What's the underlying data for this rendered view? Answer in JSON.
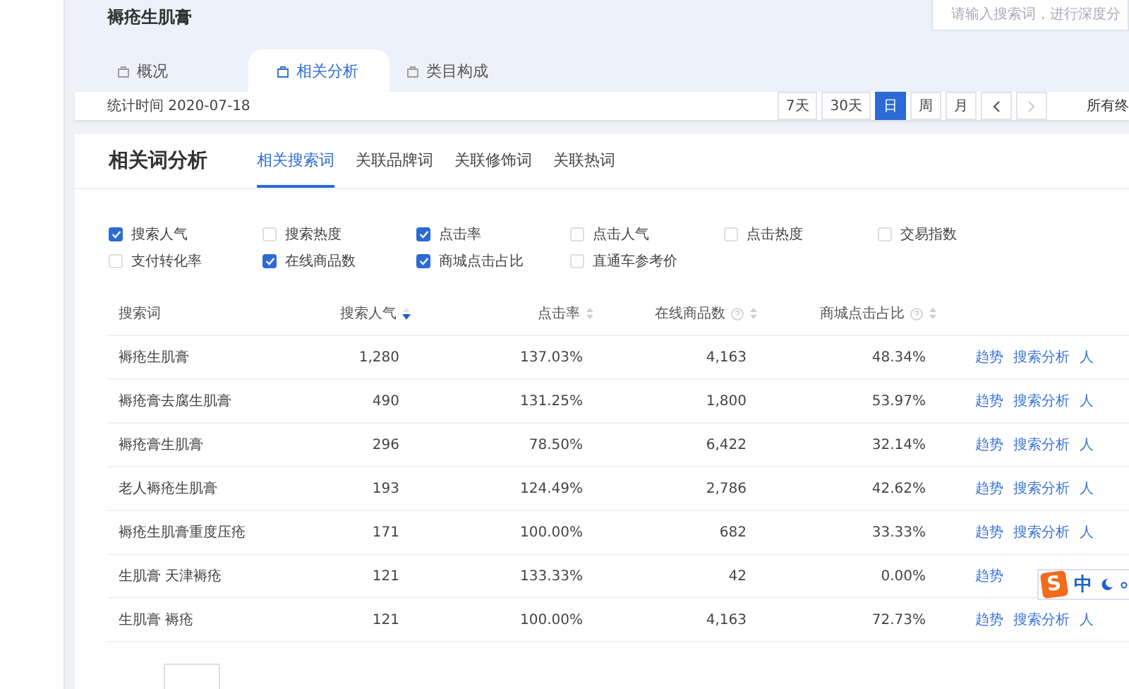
{
  "header": {
    "title": "褥疮生肌膏",
    "search": {
      "placeholder": "请输入搜索词，进行深度分"
    },
    "tabs": [
      {
        "label": "概况",
        "selected": false
      },
      {
        "label": "相关分析",
        "selected": true
      },
      {
        "label": "类目构成",
        "selected": false
      }
    ]
  },
  "toolbar": {
    "stat_time": "统计时间 2020-07-18",
    "periods": [
      {
        "label": "7天",
        "selected": false
      },
      {
        "label": "30天",
        "selected": false
      },
      {
        "label": "日",
        "selected": true
      },
      {
        "label": "周",
        "selected": false
      },
      {
        "label": "月",
        "selected": false
      }
    ],
    "next_disabled": true,
    "terminal_label": "所有终"
  },
  "panel": {
    "title": "相关词分析",
    "tabs": [
      {
        "label": "相关搜索词",
        "selected": true
      },
      {
        "label": "关联品牌词",
        "selected": false
      },
      {
        "label": "关联修饰词",
        "selected": false
      },
      {
        "label": "关联热词",
        "selected": false
      }
    ],
    "metrics": [
      {
        "label": "搜索人气",
        "checked": true
      },
      {
        "label": "搜索热度",
        "checked": false
      },
      {
        "label": "点击率",
        "checked": true
      },
      {
        "label": "点击人气",
        "checked": false
      },
      {
        "label": "点击热度",
        "checked": false
      },
      {
        "label": "交易指数",
        "checked": false
      },
      {
        "label": "支付转化率",
        "checked": false
      },
      {
        "label": "在线商品数",
        "checked": true
      },
      {
        "label": "商城点击占比",
        "checked": true
      },
      {
        "label": "直通车参考价",
        "checked": false
      }
    ],
    "table": {
      "columns": [
        {
          "label": "搜索词",
          "sortable": false,
          "help": false
        },
        {
          "label": "搜索人气",
          "sortable": true,
          "sorted": true,
          "help": false
        },
        {
          "label": "点击率",
          "sortable": true,
          "sorted": false,
          "help": false
        },
        {
          "label": "在线商品数",
          "sortable": true,
          "sorted": false,
          "help": true
        },
        {
          "label": "商城点击占比",
          "sortable": true,
          "sorted": false,
          "help": true
        }
      ],
      "rows": [
        {
          "cells": [
            "褥疮生肌膏",
            "1,280",
            "137.03%",
            "4,163",
            "48.34%"
          ],
          "actions": [
            "趋势",
            "搜索分析",
            "人"
          ]
        },
        {
          "cells": [
            "褥疮膏去腐生肌膏",
            "490",
            "131.25%",
            "1,800",
            "53.97%"
          ],
          "actions": [
            "趋势",
            "搜索分析",
            "人"
          ]
        },
        {
          "cells": [
            "褥疮膏生肌膏",
            "296",
            "78.50%",
            "6,422",
            "32.14%"
          ],
          "actions": [
            "趋势",
            "搜索分析",
            "人"
          ]
        },
        {
          "cells": [
            "老人褥疮生肌膏",
            "193",
            "124.49%",
            "2,786",
            "42.62%"
          ],
          "actions": [
            "趋势",
            "搜索分析",
            "人"
          ]
        },
        {
          "cells": [
            "褥疮生肌膏重度压疮",
            "171",
            "100.00%",
            "682",
            "33.33%"
          ],
          "actions": [
            "趋势",
            "搜索分析",
            "人"
          ]
        },
        {
          "cells": [
            "生肌膏 天津褥疮",
            "121",
            "133.33%",
            "42",
            "0.00%"
          ],
          "actions": [
            "趋势"
          ]
        },
        {
          "cells": [
            "生肌膏 褥疮",
            "121",
            "100.00%",
            "4,163",
            "72.73%"
          ],
          "actions": [
            "趋势",
            "搜索分析",
            "人"
          ]
        }
      ]
    }
  },
  "ime_toolbar": {
    "logo": "S",
    "mode": "中"
  }
}
